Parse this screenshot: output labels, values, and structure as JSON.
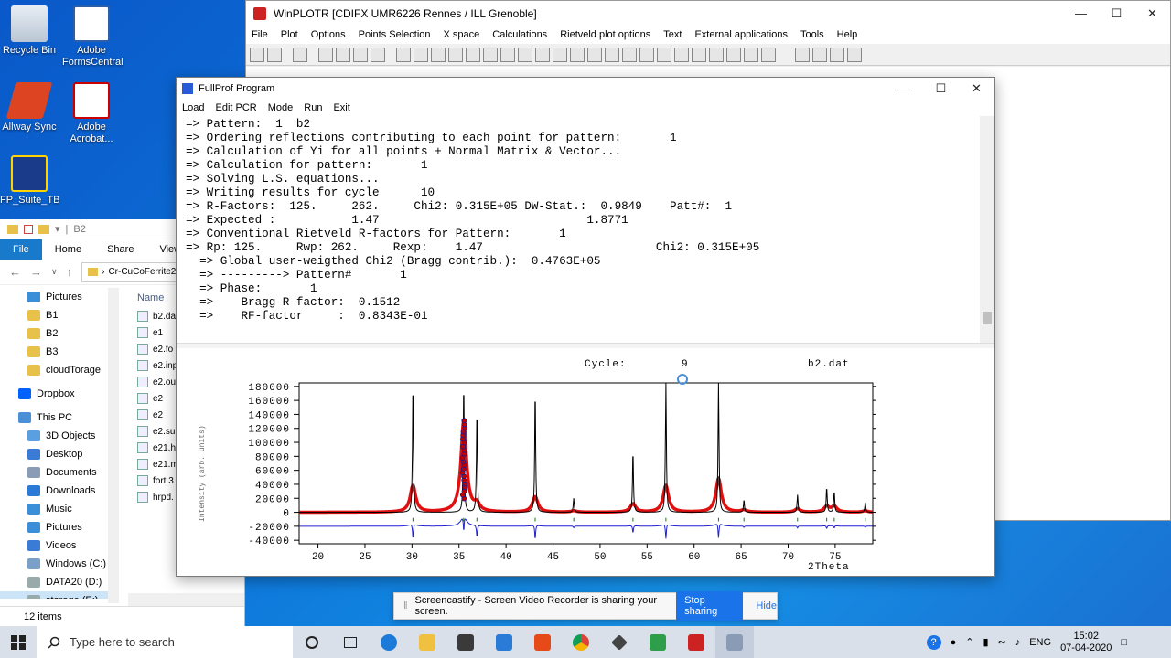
{
  "desktop": {
    "icons": [
      {
        "label": "Recycle Bin"
      },
      {
        "label": "Adobe FormsCentral"
      },
      {
        "label": "Allway Sync"
      },
      {
        "label": "Adobe Acrobat..."
      },
      {
        "label": "FP_Suite_TB"
      }
    ]
  },
  "winplotr": {
    "title": "WinPLOTR [CDIFX UMR6226 Rennes / ILL Grenoble]",
    "menu": [
      "File",
      "Plot",
      "Options",
      "Points Selection",
      "X space",
      "Calculations",
      "Rietveld plot options",
      "Text",
      "External applications",
      "Tools",
      "Help"
    ]
  },
  "explorer": {
    "title": "B2",
    "ribbon": [
      "File",
      "Home",
      "Share",
      "View"
    ],
    "address": "Cr-CuCoFerrite2",
    "nav": [
      "Pictures",
      "B1",
      "B2",
      "B3",
      "cloudTorage",
      "Dropbox",
      "This PC",
      "3D Objects",
      "Desktop",
      "Documents",
      "Downloads",
      "Music",
      "Pictures",
      "Videos",
      "Windows (C:)",
      "DATA20 (D:)",
      "storage (E:)"
    ],
    "name_header": "Name",
    "files": [
      "b2.da",
      "e1",
      "e2.fo",
      "e2.inp",
      "e2.ou",
      "e2",
      "e2",
      "e2.su",
      "e21.h",
      "e21.m",
      "fort.3",
      "hrpd."
    ],
    "status": "12 items"
  },
  "fullprof": {
    "title": "FullProf Program",
    "menu": [
      "Load",
      "Edit PCR",
      "Mode",
      "Run",
      "Exit"
    ],
    "console": [
      "=> Pattern:  1  b2",
      "=> Ordering reflections contributing to each point for pattern:       1",
      "=> Calculation of Yi for all points + Normal Matrix & Vector...",
      "=> Calculation for pattern:       1",
      "=> Solving L.S. equations...",
      "=> Writing results for cycle      10",
      "=> R-Factors:  125.     262.     Chi2: 0.315E+05 DW-Stat.:  0.9849    Patt#:  1",
      "=> Expected :           1.47                              1.8771",
      "=> Conventional Rietveld R-factors for Pattern:       1",
      "=> Rp: 125.     Rwp: 262.     Rexp:    1.47                         Chi2: 0.315E+05",
      "  => Global user-weigthed Chi2 (Bragg contrib.):  0.4763E+05",
      "  => ---------> Pattern#       1",
      "  => Phase:       1",
      "  =>    Bragg R-factor:  0.1512",
      "  =>    RF-factor     :  0.8343E-01"
    ]
  },
  "chart_data": {
    "type": "line",
    "title_left": "Cycle:",
    "cycle_value": "9",
    "title_right": "b2.dat",
    "ylabel": "Intensity (arb. units)",
    "xlabel": "2Theta",
    "xlim": [
      18,
      79
    ],
    "ylim": [
      -45000,
      185000
    ],
    "x_ticks": [
      "20",
      "25",
      "30",
      "35",
      "40",
      "45",
      "50",
      "55",
      "60",
      "65",
      "70",
      "75"
    ],
    "y_ticks": [
      "180000",
      "160000",
      "140000",
      "120000",
      "100000",
      "80000",
      "60000",
      "40000",
      "20000",
      "0",
      "-20000",
      "-40000"
    ],
    "background": 0,
    "diff_offset": -20000,
    "peaks": [
      {
        "x": 30.1,
        "obs": 38000,
        "calc": 185000
      },
      {
        "x": 35.5,
        "obs": 130000,
        "calc": 185000
      },
      {
        "x": 36.9,
        "obs": 10000,
        "calc": 145000
      },
      {
        "x": 43.1,
        "obs": 22000,
        "calc": 175000
      },
      {
        "x": 47.2,
        "obs": 2000,
        "calc": 20000
      },
      {
        "x": 53.5,
        "obs": 12000,
        "calc": 88000
      },
      {
        "x": 57.0,
        "obs": 38000,
        "calc": 185000
      },
      {
        "x": 62.6,
        "obs": 48000,
        "calc": 185000
      },
      {
        "x": 65.3,
        "obs": 3000,
        "calc": 18000
      },
      {
        "x": 71.0,
        "obs": 5000,
        "calc": 25000
      },
      {
        "x": 74.1,
        "obs": 8000,
        "calc": 36000
      },
      {
        "x": 74.9,
        "obs": 8000,
        "calc": 30000
      },
      {
        "x": 78.2,
        "obs": 2000,
        "calc": 14000
      }
    ],
    "colors": {
      "obs": "#e01010",
      "obs_marker": "#c00000",
      "calc": "#000000",
      "diff": "#2020d0",
      "bragg": "#008000"
    }
  },
  "screencastify": {
    "message": "Screencastify - Screen Video Recorder is sharing your screen.",
    "stop": "Stop sharing",
    "hide": "Hide"
  },
  "taskbar": {
    "search_placeholder": "Type here to search",
    "lang": "ENG",
    "time": "15:02",
    "date": "07-04-2020"
  }
}
